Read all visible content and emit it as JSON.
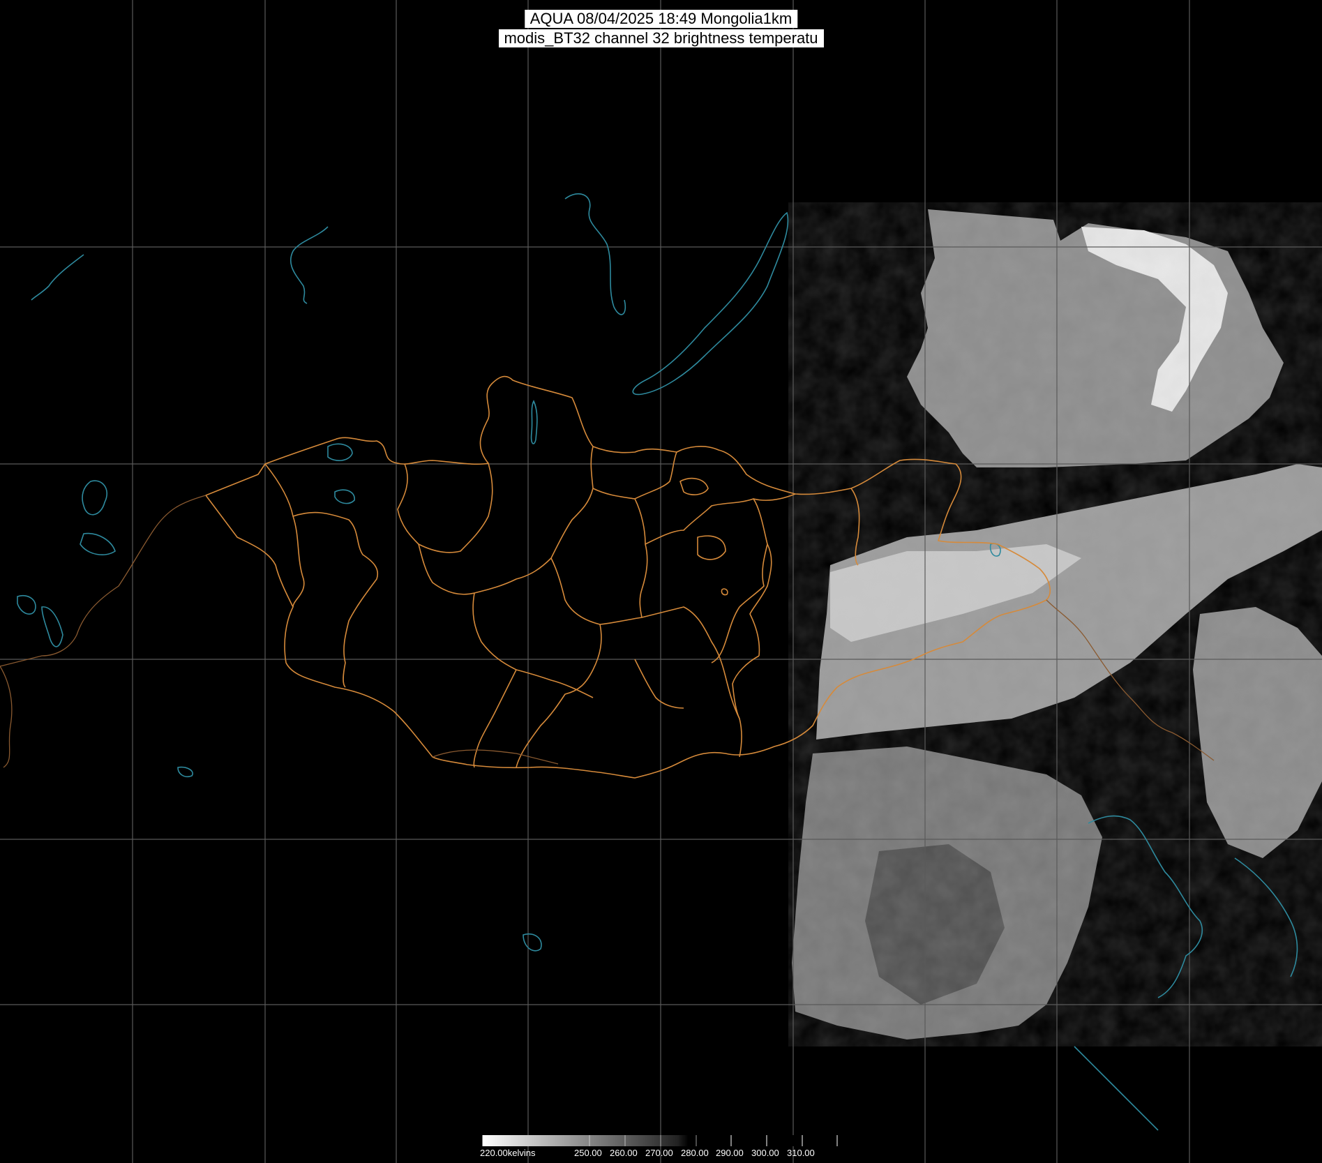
{
  "title": {
    "line1": "AQUA 08/04/2025 18:49 Mongolia1km",
    "line2": "modis_BT32 channel 32 brightness temperatu"
  },
  "colorbar": {
    "unit_label": "220.00kelvins",
    "ticks": [
      "250.00",
      "260.00",
      "270.00",
      "280.00",
      "290.00",
      "300.00",
      "310.00"
    ],
    "range": [
      220,
      320
    ],
    "colormap": "grayscale, white = cold, black = warm"
  },
  "colors": {
    "background": "#000000",
    "graticule": "#5a5a5a",
    "admin_borders": "#d68a3a",
    "water": "#2e8a9e",
    "title_bg": "#ffffff"
  },
  "map": {
    "region": "Mongolia",
    "satellite": "AQUA",
    "sensor": "MODIS",
    "channel": 32
  }
}
